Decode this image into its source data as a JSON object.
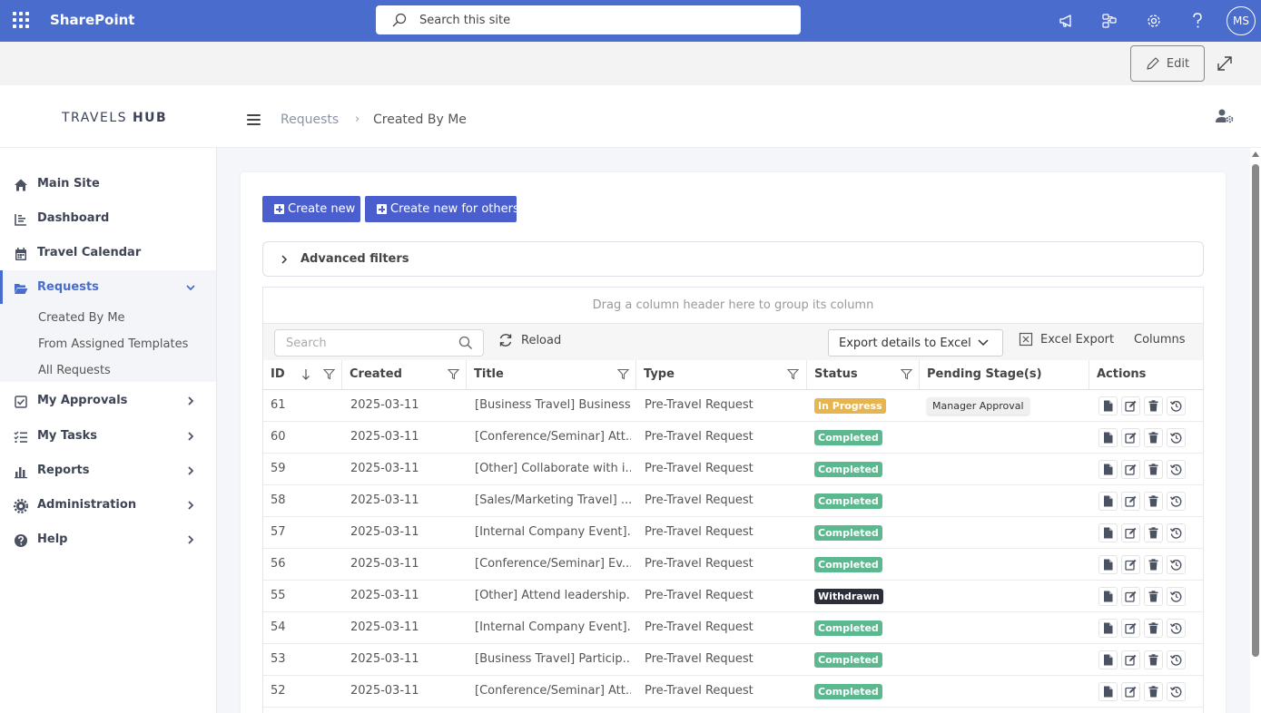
{
  "topbar": {
    "brand": "SharePoint",
    "search_placeholder": "Search this site",
    "avatar": "MS",
    "color": "#4a6dcd"
  },
  "cmdbar": {
    "edit_label": "Edit"
  },
  "header": {
    "logo_light": "TRAVELS ",
    "logo_bold": "HUB",
    "breadcrumb": [
      "Requests",
      "Created By Me"
    ],
    "separator": "›"
  },
  "sidebar": {
    "items": [
      {
        "label": "Main Site",
        "icon": "home-icon"
      },
      {
        "label": "Dashboard",
        "icon": "chart-icon"
      },
      {
        "label": "Travel Calendar",
        "icon": "calendar-icon"
      },
      {
        "label": "Requests",
        "icon": "folder-open-icon",
        "active": true
      },
      {
        "label": "My Approvals",
        "icon": "checkbox-icon"
      },
      {
        "label": "My Tasks",
        "icon": "tasks-icon"
      },
      {
        "label": "Reports",
        "icon": "bar-chart-icon"
      },
      {
        "label": "Administration",
        "icon": "gear-icon"
      },
      {
        "label": "Help",
        "icon": "help-icon"
      }
    ],
    "sub_items": [
      "Created By Me",
      "From Assigned Templates",
      "All Requests"
    ]
  },
  "actions": {
    "create_new": "Create new",
    "create_for_others": "Create new for others",
    "advanced_filters": "Advanced filters"
  },
  "grid": {
    "group_panel": "Drag a column header here to group its column",
    "search_placeholder": "Search",
    "reload": "Reload",
    "export_details": "Export details to Excel",
    "excel_export": "Excel Export",
    "columns": "Columns",
    "headers": [
      "ID",
      "Created",
      "Title",
      "Type",
      "Status",
      "Pending Stage(s)",
      "Actions"
    ],
    "rows": [
      {
        "id": "61",
        "created": "2025-03-11",
        "title": "[Business Travel] Business...",
        "type": "Pre-Travel Request",
        "status": "In Progress",
        "stage": "Manager Approval"
      },
      {
        "id": "60",
        "created": "2025-03-11",
        "title": "[Conference/Seminar] Att...",
        "type": "Pre-Travel Request",
        "status": "Completed",
        "stage": ""
      },
      {
        "id": "59",
        "created": "2025-03-11",
        "title": "[Other] Collaborate with i...",
        "type": "Pre-Travel Request",
        "status": "Completed",
        "stage": ""
      },
      {
        "id": "58",
        "created": "2025-03-11",
        "title": "[Sales/Marketing Travel] ...",
        "type": "Pre-Travel Request",
        "status": "Completed",
        "stage": ""
      },
      {
        "id": "57",
        "created": "2025-03-11",
        "title": "[Internal Company Event]...",
        "type": "Pre-Travel Request",
        "status": "Completed",
        "stage": ""
      },
      {
        "id": "56",
        "created": "2025-03-11",
        "title": "[Conference/Seminar] Ev...",
        "type": "Pre-Travel Request",
        "status": "Completed",
        "stage": ""
      },
      {
        "id": "55",
        "created": "2025-03-11",
        "title": "[Other] Attend leadership...",
        "type": "Pre-Travel Request",
        "status": "Withdrawn",
        "stage": ""
      },
      {
        "id": "54",
        "created": "2025-03-11",
        "title": "[Internal Company Event]...",
        "type": "Pre-Travel Request",
        "status": "Completed",
        "stage": ""
      },
      {
        "id": "53",
        "created": "2025-03-11",
        "title": "[Business Travel] Particip...",
        "type": "Pre-Travel Request",
        "status": "Completed",
        "stage": ""
      },
      {
        "id": "52",
        "created": "2025-03-11",
        "title": "[Conference/Seminar] Att...",
        "type": "Pre-Travel Request",
        "status": "Completed",
        "stage": ""
      }
    ],
    "status_colors": {
      "In Progress": "#e8b44d",
      "Completed": "#5cb88f",
      "Withdrawn": "#2c2f3a"
    }
  }
}
